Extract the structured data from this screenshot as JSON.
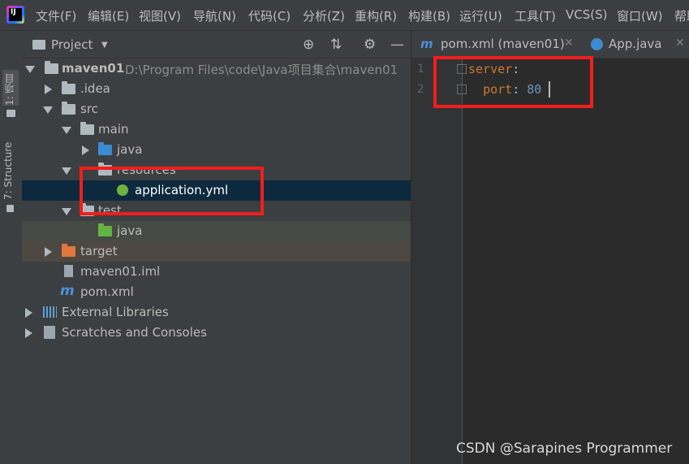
{
  "menubar": {
    "items": [
      "文件(F)",
      "编辑(E)",
      "视图(V)",
      "导航(N)",
      "代码(C)",
      "分析(Z)",
      "重构(R)",
      "构建(B)",
      "运行(U)",
      "工具(T)",
      "VCS(S)",
      "窗口(W)",
      "帮助"
    ],
    "logo_text": "IJ"
  },
  "left_strip": {
    "project_tab": "1: 项目",
    "structure_tab": "7: Structure"
  },
  "project_panel": {
    "title": "Project",
    "tree": [
      {
        "label": "maven01",
        "path": "D:\\Program Files\\code\\Java项目集合\\maven01"
      },
      {
        "label": ".idea"
      },
      {
        "label": "src"
      },
      {
        "label": "main"
      },
      {
        "label": "java"
      },
      {
        "label": "resources"
      },
      {
        "label": "application.yml"
      },
      {
        "label": "test"
      },
      {
        "label": "java"
      },
      {
        "label": "target"
      },
      {
        "label": "maven01.iml"
      },
      {
        "label": "pom.xml"
      },
      {
        "label": "External Libraries"
      },
      {
        "label": "Scratches and Consoles"
      }
    ]
  },
  "editor": {
    "tabs": [
      {
        "label": "pom.xml (maven01)",
        "icon": "m"
      },
      {
        "label": "App.java"
      }
    ],
    "lines": [
      {
        "num": "1",
        "key": "server",
        "colon": ":",
        "value": ""
      },
      {
        "num": "2",
        "key": "port",
        "colon": ": ",
        "value": "80"
      }
    ]
  },
  "watermark": "CSDN @Sarapines Programmer",
  "colors": {
    "highlight": "#f21d1d",
    "selection": "#0d293e",
    "keyword": "#cc7832",
    "number": "#6897bb"
  }
}
